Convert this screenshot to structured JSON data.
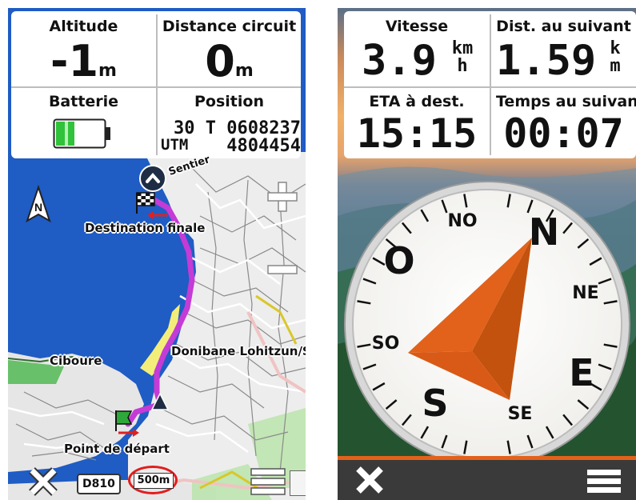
{
  "left": {
    "fields": {
      "altitude_label": "Altitude",
      "altitude_value": "-1",
      "altitude_unit": "m",
      "distance_label": "Distance circuit",
      "distance_value": "0",
      "distance_unit": "m",
      "battery_label": "Batterie",
      "position_label": "Position",
      "position_line1": "30 T 0608237",
      "position_line2_prefix": "UTM",
      "position_line2_value": "4804454"
    },
    "battery_level": 0.4,
    "map": {
      "compass_letter": "N",
      "labels": {
        "sentier": "Sentier",
        "destination": "Destination finale",
        "ciboure": "Ciboure",
        "donibane": "Donibane Lohitzun/St J",
        "start": "Point de départ",
        "road": "D810",
        "scale": "500m"
      },
      "zoom_in": "+",
      "zoom_out": "−",
      "close": "✕",
      "menu": "≡"
    }
  },
  "right": {
    "fields": {
      "speed_label": "Vitesse",
      "speed_value": "3.9",
      "speed_unit_top": "km",
      "speed_unit_bottom": "h",
      "next_label": "Dist. au suivant",
      "next_value": "1.59",
      "next_unit_top": "k",
      "next_unit_bottom": "m",
      "eta_label": "ETA à dest.",
      "eta_value": "15:15",
      "time_label": "Temps au suivan",
      "time_value": "00:07"
    },
    "compass": {
      "n": "N",
      "ne": "NE",
      "e": "E",
      "se": "SE",
      "s": "S",
      "so": "SO",
      "o": "O",
      "no": "NO"
    },
    "close": "✕",
    "menu": "≡"
  },
  "colors": {
    "water": "#1f5cc4",
    "route": "#c43bd6",
    "accent_orange": "#e2621b",
    "battery_green": "#30c23a"
  }
}
